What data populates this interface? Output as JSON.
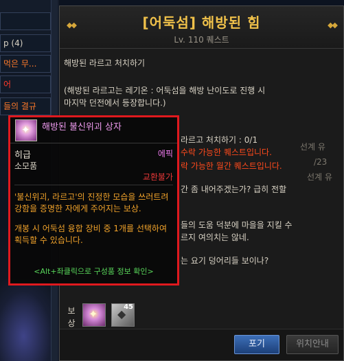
{
  "quest_list": {
    "items": [
      {
        "label": "",
        "color": "#d8d2c4"
      },
      {
        "label": "p (4)",
        "color": "#d8d2c4"
      },
      {
        "label": "먹은 무...",
        "color": "#ff7a2a"
      },
      {
        "label": "어",
        "color": "#ff3a2a"
      },
      {
        "label": "들의 결규",
        "color": "#ff7a2a"
      }
    ]
  },
  "panel": {
    "title": "[어둑섬] 해방된 힘",
    "subtitle": "Lv. 110 퀘스트"
  },
  "quest_body": {
    "objective": "해방된 라르고 처치하기",
    "description_line1": "(해방된 라르고는 레기온 : 어둑섬을 해방 난이도로 진행 시",
    "description_line2": "마지막 던전에서 등장합니다.)",
    "progress": "라르고 처치하기 : 0/1",
    "notice1": "수락 가능한 퀘스트입니다.",
    "notice2": "락 가능한 월간 퀘스트입니다.",
    "dialogue1": "간 좀 내어주겠는가? 급히 전할",
    "dialogue2": "들의 도움 덕분에 마을을 지킬 수",
    "dialogue3": "르지 여의치는 않네.",
    "dialogue4": "는 요기 덩어리들 보이나?",
    "faded1": "선계 유",
    "faded2": "선계 유",
    "faded3": "/23"
  },
  "rewards": {
    "label": "보상",
    "slot2_count": "45"
  },
  "buttons": {
    "give_up": "포기",
    "location": "위치안내"
  },
  "tooltip": {
    "item_name": "해방된 불신위괴 상자",
    "grade_left": "히급",
    "item_type": "소모품",
    "grade_right": "에픽",
    "trade_status": "교환불가",
    "description1": "'불신위괴, 라르고'의 진정한 모습을 쓰러트려 강함을 증명한 자에게 주어지는 보상.",
    "description2": "개봉 시 어둑섬 융합 장비 중 1개를 선택하여 획득할 수 있습니다.",
    "hint": "<Alt+좌클릭으로 구성품 정보 확인>"
  },
  "colors": {
    "border_highlight": "#e0191e",
    "title_gold": "#f0c14a",
    "epic_pink": "#f07cf0",
    "description_orange": "#f0a22a",
    "hint_green": "#58d65a",
    "notice_red": "#ff4a1c"
  }
}
